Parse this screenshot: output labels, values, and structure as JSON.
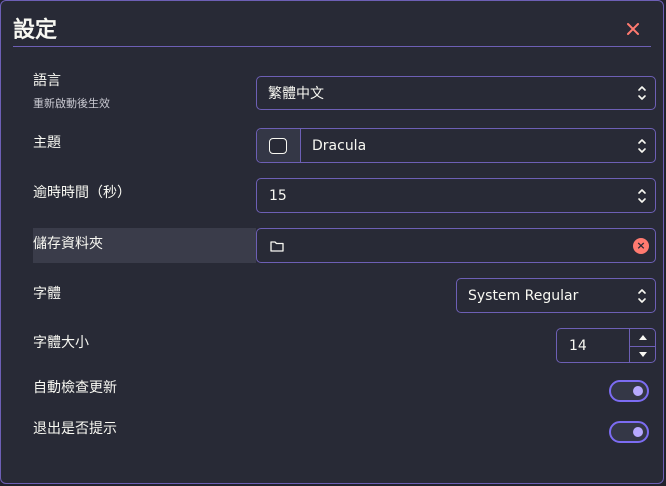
{
  "dialog": {
    "title": "設定"
  },
  "settings": {
    "language": {
      "label": "語言",
      "sublabel": "重新啟動後生效",
      "value": "繁體中文"
    },
    "theme": {
      "label": "主題",
      "value": "Dracula"
    },
    "timeout": {
      "label": "逾時時間（秒）",
      "value": "15"
    },
    "storage": {
      "label": "儲存資料夾",
      "value": ""
    },
    "font": {
      "label": "字體",
      "value": "System Regular"
    },
    "font_size": {
      "label": "字體大小",
      "value": "14"
    },
    "auto_update": {
      "label": "自動檢查更新",
      "enabled": true
    },
    "exit_prompt": {
      "label": "退出是否提示",
      "enabled": true
    }
  },
  "colors": {
    "background": "#282a36",
    "accent": "#7c6cf2",
    "border": "#6d5fb5",
    "close": "#ff7a70"
  },
  "icons": {
    "close": "close-icon",
    "folder": "folder-icon",
    "chevron": "chevron-up-down-icon",
    "clear": "clear-icon"
  }
}
